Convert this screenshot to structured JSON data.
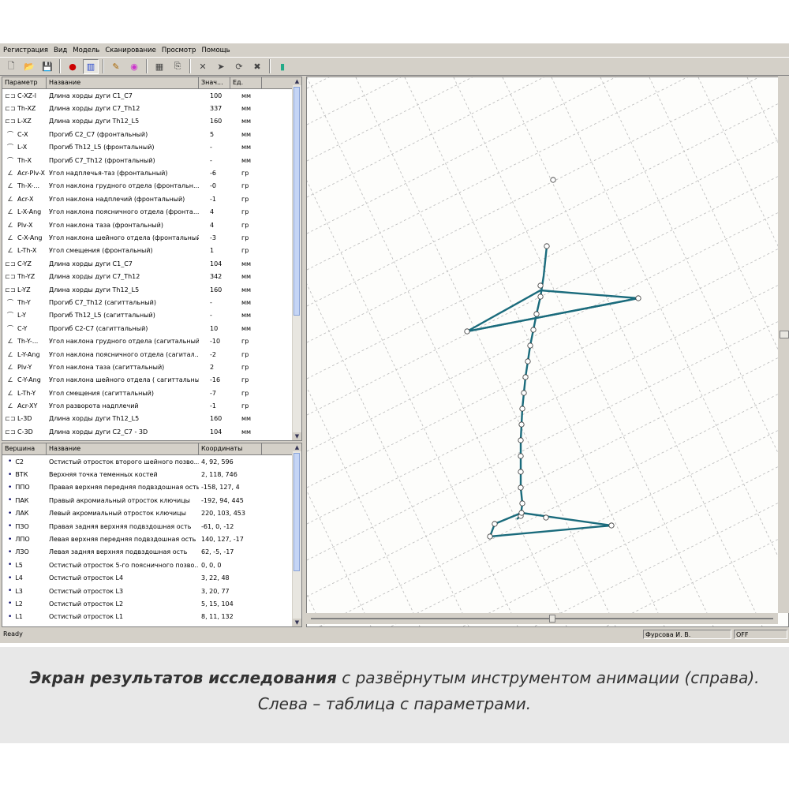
{
  "menu": [
    "Регистрация",
    "Вид",
    "Модель",
    "Сканирование",
    "Просмотр",
    "Помощь"
  ],
  "toolbar_icons": [
    "new-icon",
    "open-icon",
    "save-icon",
    "record-icon",
    "view-icon",
    "palette-icon",
    "colors-icon",
    "grid-icon",
    "export-icon",
    "scale-icon",
    "move-icon",
    "rotate-icon",
    "close-icon",
    "book-icon"
  ],
  "params": {
    "headers": [
      "Параметр",
      "Название",
      "Знач...",
      "Ед."
    ],
    "rows": [
      [
        "C-XZ-l",
        "Длина хорды дуги С1_С7",
        "100",
        "мм"
      ],
      [
        "Th-XZ",
        "Длина хорды дуги С7_Th12",
        "337",
        "мм"
      ],
      [
        "L-XZ",
        "Длина хорды дуги Th12_L5",
        "160",
        "мм"
      ],
      [
        "C-X",
        "Прогиб С2_С7 (фронтальный)",
        "5",
        "мм"
      ],
      [
        "L-X",
        "Прогиб Th12_L5 (фронтальный)",
        "-",
        "мм"
      ],
      [
        "Th-X",
        "Прогиб С7_Th12 (фронтальный)",
        "-",
        "мм"
      ],
      [
        "Acr-Plv-X",
        "Угол надплечья-таз (фронтальный)",
        "-6",
        "гр"
      ],
      [
        "Th-X-...",
        "Угол наклона грудного отдела (фронтальн...",
        "-0",
        "гр"
      ],
      [
        "Acr-X",
        "Угол наклона надплечий (фронтальный)",
        "-1",
        "гр"
      ],
      [
        "L-X-Ang",
        "Угол наклона поясничного отдела (фронта...",
        "4",
        "гр"
      ],
      [
        "Plv-X",
        "Угол наклона таза (фронтальный)",
        "4",
        "гр"
      ],
      [
        "C-X-Ang",
        "Угол наклона шейного отдела (фронтальный)",
        "-3",
        "гр"
      ],
      [
        "L-Th-X",
        "Угол смещения (фронтальный)",
        "1",
        "гр"
      ],
      [
        "C-YZ",
        "Длина хорды дуги С1_С7",
        "104",
        "мм"
      ],
      [
        "Th-YZ",
        "Длина хорды дуги С7_Th12",
        "342",
        "мм"
      ],
      [
        "L-YZ",
        "Длина хорды дуги Th12_L5",
        "160",
        "мм"
      ],
      [
        "Th-Y",
        "Прогиб С7_Th12 (сагиттальный)",
        "-",
        "мм"
      ],
      [
        "L-Y",
        "Прогиб Th12_L5 (сагиттальный)",
        "-",
        "мм"
      ],
      [
        "C-Y",
        "Прогиб С2-С7 (сагиттальный)",
        "10",
        "мм"
      ],
      [
        "Th-Y-...",
        "Угол наклона грудного отдела (сагитальный)",
        "-10",
        "гр"
      ],
      [
        "L-Y-Ang",
        "Угол наклона поясничного отдела (сагитал...",
        "-2",
        "гр"
      ],
      [
        "Plv-Y",
        "Угол наклона таза (сагиттальный)",
        "2",
        "гр"
      ],
      [
        "C-Y-Ang",
        "Угол наклона шейного отдела ( сагиттальный)",
        "-16",
        "гр"
      ],
      [
        "L-Th-Y",
        "Угол смещения (сагиттальный)",
        "-7",
        "гр"
      ],
      [
        "Acr-XY",
        "Угол разворота надплечий",
        "-1",
        "гр"
      ],
      [
        "L-3D",
        "Длина хорды дуги Th12_L5",
        "160",
        "мм"
      ],
      [
        "C-3D",
        "Длина хорды дуги С2_С7 - 3D",
        "104",
        "мм"
      ]
    ]
  },
  "vertices": {
    "headers": [
      "Вершина",
      "Название",
      "Координаты"
    ],
    "rows": [
      [
        "C2",
        "Остистый отросток второго шейного позво...",
        "4, 92, 596"
      ],
      [
        "ВТК",
        "Верхняя точка теменных костей",
        "2, 118, 746"
      ],
      [
        "ППО",
        "Правая верхняя передняя подвздошная ость",
        "-158, 127, 4"
      ],
      [
        "ПАК",
        "Правый акромиальный отросток  ключицы",
        "-192, 94, 445"
      ],
      [
        "ЛАК",
        "Левый акромиальный отросток  ключицы",
        "220, 103, 453"
      ],
      [
        "ПЗО",
        "Правая задняя верхняя подвздошная ость",
        "-61, 0, -12"
      ],
      [
        "ЛПО",
        "Левая верхняя передняя подвздошная ость",
        "140, 127, -17"
      ],
      [
        "ЛЗО",
        "Левая задняя верхняя подвздошная ость",
        "62, -5, -17"
      ],
      [
        "L5",
        " Остистый отросток 5-го поясничного позво...",
        "0, 0, 0"
      ],
      [
        "L4",
        "Остистый отросток L4",
        "3, 22, 48"
      ],
      [
        "L3",
        "Остистый отросток L3",
        "3, 20, 77"
      ],
      [
        "L2",
        "Остистый отросток L2",
        "5, 15, 104"
      ],
      [
        "L1",
        "Остистый отросток L1",
        "8, 11, 132"
      ]
    ]
  },
  "status": {
    "left": "Ready",
    "user": "Фурсова И. В.",
    "mode": "OFF"
  },
  "caption": {
    "bold": "Экран результатов исследования",
    "rest": " с развёрнутым инструментом анимации (справа).",
    "line2": "Слева – таблица с параметрами."
  }
}
